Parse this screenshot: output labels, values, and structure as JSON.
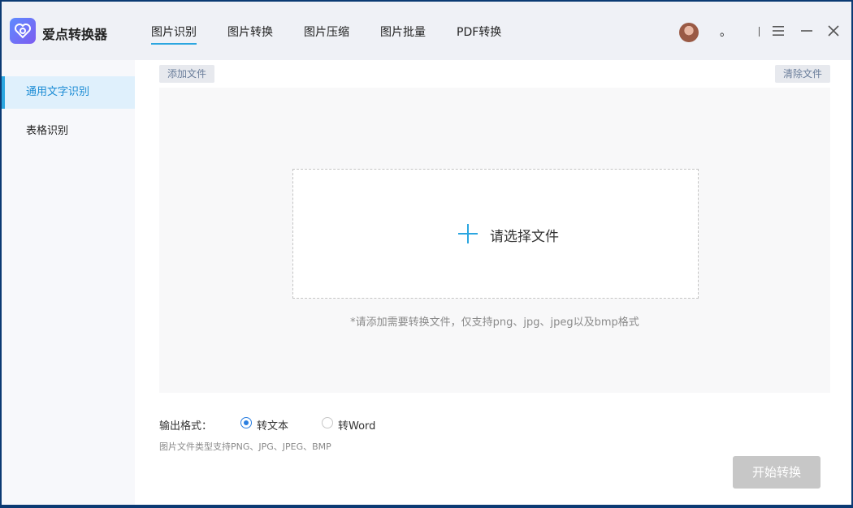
{
  "app": {
    "title": "爱点转换器"
  },
  "nav": {
    "tabs": [
      "图片识别",
      "图片转换",
      "图片压缩",
      "图片批量",
      "PDF转换"
    ],
    "active_tab": 0
  },
  "titlebar": {
    "dot_text": "。"
  },
  "sidebar": {
    "items": [
      "通用文字识别",
      "表格识别"
    ],
    "active_item": 0
  },
  "toolbar": {
    "add_label": "添加文件",
    "clear_label": "清除文件"
  },
  "dropzone": {
    "label": "请选择文件",
    "hint": "*请添加需要转换文件，仅支持png、jpg、jpeg以及bmp格式"
  },
  "output": {
    "label": "输出格式：",
    "options": [
      "转文本",
      "转Word"
    ],
    "selected": 0,
    "support_text": "图片文件类型支持PNG、JPG、JPEG、BMP"
  },
  "start_button": {
    "label": "开始转换"
  },
  "colors": {
    "accent": "#2ba6e0",
    "radio": "#2a7ee0",
    "disabled_button": "#c7c7c7"
  }
}
